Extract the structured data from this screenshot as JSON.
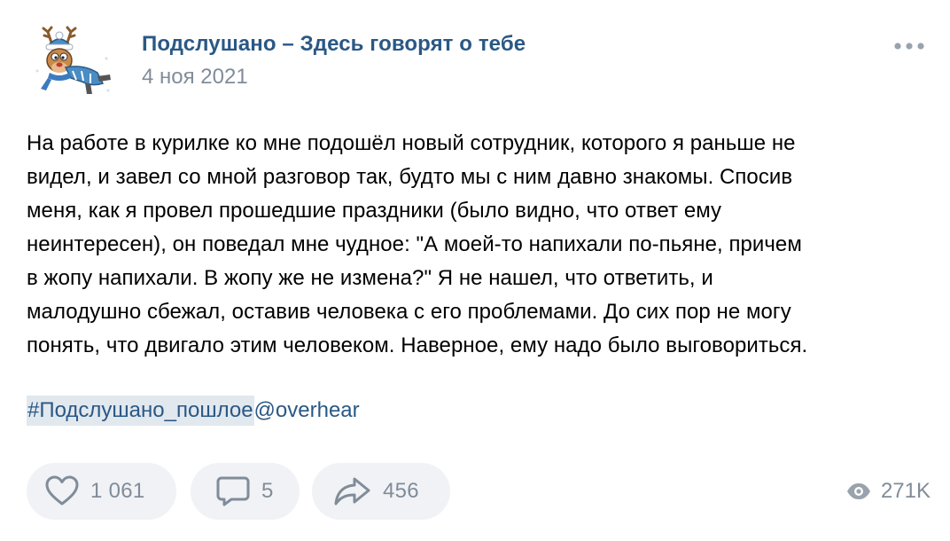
{
  "post": {
    "author": {
      "name": "Подслушано – Здесь говорят о тебе",
      "avatar_icon": "reindeer-mascot-icon"
    },
    "date": "4 ноя 2021",
    "more_icon": "more-dots-icon",
    "text_lines": [
      "На работе в курилке ко мне подошёл новый сотрудник, которого я раньше не",
      "видел, и завел со мной разговор так, будто мы с ним давно знакомы. Спосив",
      "меня, как я провел прошедшие праздники (было видно, что ответ ему",
      "неинтересен), он поведал мне чудное: \"А моей-то напихали по-пьяне, причем",
      "в жопу напихали. В жопу же не измена?\" Я не нашел, что ответить, и",
      "малодушно сбежал, оставив человека с его проблемами. До сих пор не могу",
      "понять, что двигало этим человеком. Наверное, ему надо было выговориться."
    ],
    "hashtag": "#Подслушано_пошлое",
    "mention": "@overhear",
    "actions": {
      "likes": {
        "icon": "heart-icon",
        "count": "1 061"
      },
      "comments": {
        "icon": "comment-icon",
        "count": "5"
      },
      "shares": {
        "icon": "share-icon",
        "count": "456"
      }
    },
    "views": {
      "icon": "eye-icon",
      "count": "271K"
    }
  },
  "colors": {
    "link": "#2a5885",
    "secondary_text": "#818c99",
    "button_bg": "#f0f2f5",
    "hashtag_bg": "#e1e8ee"
  }
}
